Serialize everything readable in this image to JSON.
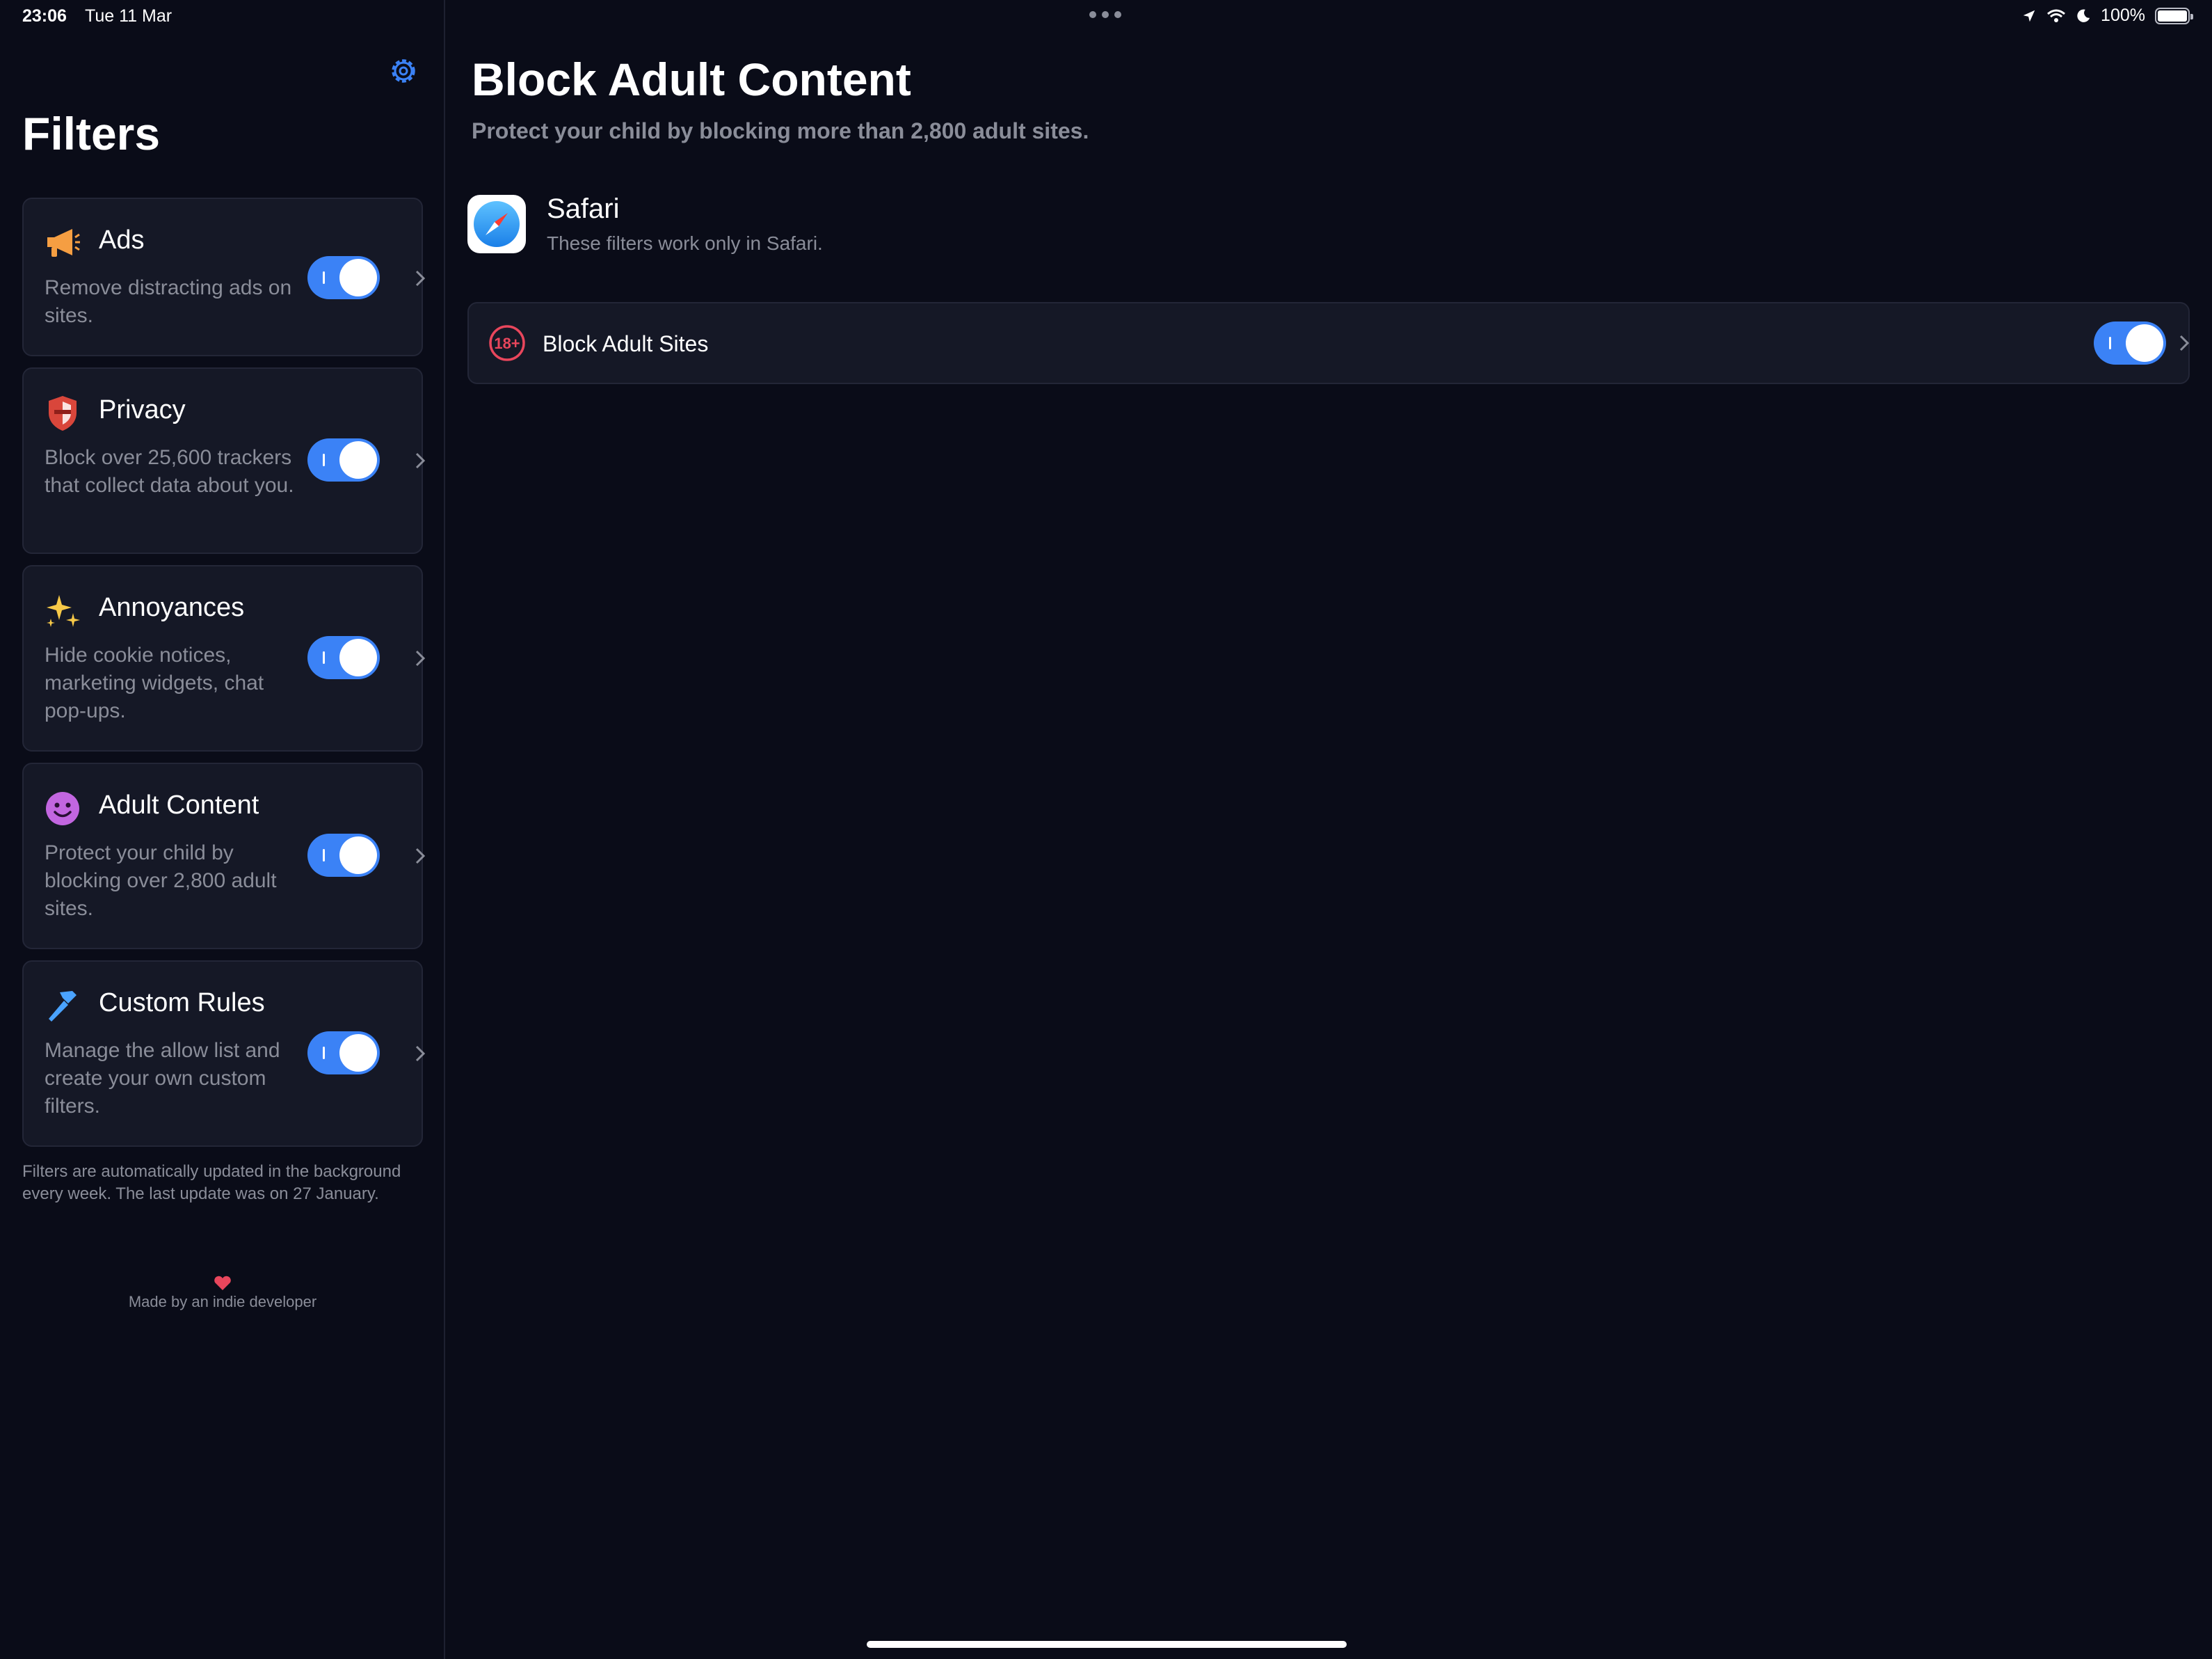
{
  "status_bar": {
    "time": "23:06",
    "date": "Tue 11 Mar",
    "battery": "100%"
  },
  "sidebar": {
    "title": "Filters",
    "settings_icon": "gear-icon",
    "filters": [
      {
        "title": "Ads",
        "description": "Remove distracting ads on sites.",
        "icon": "megaphone-icon",
        "enabled": true
      },
      {
        "title": "Privacy",
        "description": "Block over 25,600 trackers that collect data about you.",
        "icon": "shield-icon",
        "enabled": true
      },
      {
        "title": "Annoyances",
        "description": "Hide cookie notices, marketing widgets, chat pop-ups.",
        "icon": "sparkles-icon",
        "enabled": true
      },
      {
        "title": "Adult Content",
        "description": "Protect your child by blocking over 2,800 adult sites.",
        "icon": "smiley-icon",
        "enabled": true
      },
      {
        "title": "Custom Rules",
        "description": "Manage the allow list and create your own custom filters.",
        "icon": "hammer-icon",
        "enabled": true
      }
    ],
    "update_note": "Filters are automatically updated in the background every week. The last update was on 27 January.",
    "credit": "Made by an indie developer"
  },
  "main": {
    "title": "Block Adult Content",
    "subtitle": "Protect your child by blocking more than 2,800 adult sites.",
    "browser": {
      "name": "Safari",
      "description": "These filters work only in Safari."
    },
    "rules": [
      {
        "label": "Block Adult Sites",
        "icon": "18-plus-icon",
        "enabled": true
      }
    ]
  },
  "colors": {
    "background": "#0a0c18",
    "card": "#151826",
    "accent": "#3b82f6",
    "secondary_text": "#8a8d99"
  }
}
